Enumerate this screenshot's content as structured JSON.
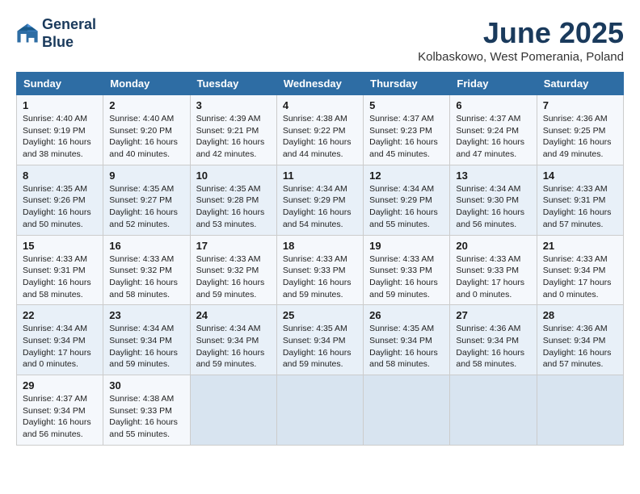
{
  "header": {
    "logo_line1": "General",
    "logo_line2": "Blue",
    "month_title": "June 2025",
    "location": "Kolbaskowo, West Pomerania, Poland"
  },
  "days_of_week": [
    "Sunday",
    "Monday",
    "Tuesday",
    "Wednesday",
    "Thursday",
    "Friday",
    "Saturday"
  ],
  "weeks": [
    [
      {
        "day": "1",
        "info": "Sunrise: 4:40 AM\nSunset: 9:19 PM\nDaylight: 16 hours\nand 38 minutes."
      },
      {
        "day": "2",
        "info": "Sunrise: 4:40 AM\nSunset: 9:20 PM\nDaylight: 16 hours\nand 40 minutes."
      },
      {
        "day": "3",
        "info": "Sunrise: 4:39 AM\nSunset: 9:21 PM\nDaylight: 16 hours\nand 42 minutes."
      },
      {
        "day": "4",
        "info": "Sunrise: 4:38 AM\nSunset: 9:22 PM\nDaylight: 16 hours\nand 44 minutes."
      },
      {
        "day": "5",
        "info": "Sunrise: 4:37 AM\nSunset: 9:23 PM\nDaylight: 16 hours\nand 45 minutes."
      },
      {
        "day": "6",
        "info": "Sunrise: 4:37 AM\nSunset: 9:24 PM\nDaylight: 16 hours\nand 47 minutes."
      },
      {
        "day": "7",
        "info": "Sunrise: 4:36 AM\nSunset: 9:25 PM\nDaylight: 16 hours\nand 49 minutes."
      }
    ],
    [
      {
        "day": "8",
        "info": "Sunrise: 4:35 AM\nSunset: 9:26 PM\nDaylight: 16 hours\nand 50 minutes."
      },
      {
        "day": "9",
        "info": "Sunrise: 4:35 AM\nSunset: 9:27 PM\nDaylight: 16 hours\nand 52 minutes."
      },
      {
        "day": "10",
        "info": "Sunrise: 4:35 AM\nSunset: 9:28 PM\nDaylight: 16 hours\nand 53 minutes."
      },
      {
        "day": "11",
        "info": "Sunrise: 4:34 AM\nSunset: 9:29 PM\nDaylight: 16 hours\nand 54 minutes."
      },
      {
        "day": "12",
        "info": "Sunrise: 4:34 AM\nSunset: 9:29 PM\nDaylight: 16 hours\nand 55 minutes."
      },
      {
        "day": "13",
        "info": "Sunrise: 4:34 AM\nSunset: 9:30 PM\nDaylight: 16 hours\nand 56 minutes."
      },
      {
        "day": "14",
        "info": "Sunrise: 4:33 AM\nSunset: 9:31 PM\nDaylight: 16 hours\nand 57 minutes."
      }
    ],
    [
      {
        "day": "15",
        "info": "Sunrise: 4:33 AM\nSunset: 9:31 PM\nDaylight: 16 hours\nand 58 minutes."
      },
      {
        "day": "16",
        "info": "Sunrise: 4:33 AM\nSunset: 9:32 PM\nDaylight: 16 hours\nand 58 minutes."
      },
      {
        "day": "17",
        "info": "Sunrise: 4:33 AM\nSunset: 9:32 PM\nDaylight: 16 hours\nand 59 minutes."
      },
      {
        "day": "18",
        "info": "Sunrise: 4:33 AM\nSunset: 9:33 PM\nDaylight: 16 hours\nand 59 minutes."
      },
      {
        "day": "19",
        "info": "Sunrise: 4:33 AM\nSunset: 9:33 PM\nDaylight: 16 hours\nand 59 minutes."
      },
      {
        "day": "20",
        "info": "Sunrise: 4:33 AM\nSunset: 9:33 PM\nDaylight: 17 hours\nand 0 minutes."
      },
      {
        "day": "21",
        "info": "Sunrise: 4:33 AM\nSunset: 9:34 PM\nDaylight: 17 hours\nand 0 minutes."
      }
    ],
    [
      {
        "day": "22",
        "info": "Sunrise: 4:34 AM\nSunset: 9:34 PM\nDaylight: 17 hours\nand 0 minutes."
      },
      {
        "day": "23",
        "info": "Sunrise: 4:34 AM\nSunset: 9:34 PM\nDaylight: 16 hours\nand 59 minutes."
      },
      {
        "day": "24",
        "info": "Sunrise: 4:34 AM\nSunset: 9:34 PM\nDaylight: 16 hours\nand 59 minutes."
      },
      {
        "day": "25",
        "info": "Sunrise: 4:35 AM\nSunset: 9:34 PM\nDaylight: 16 hours\nand 59 minutes."
      },
      {
        "day": "26",
        "info": "Sunrise: 4:35 AM\nSunset: 9:34 PM\nDaylight: 16 hours\nand 58 minutes."
      },
      {
        "day": "27",
        "info": "Sunrise: 4:36 AM\nSunset: 9:34 PM\nDaylight: 16 hours\nand 58 minutes."
      },
      {
        "day": "28",
        "info": "Sunrise: 4:36 AM\nSunset: 9:34 PM\nDaylight: 16 hours\nand 57 minutes."
      }
    ],
    [
      {
        "day": "29",
        "info": "Sunrise: 4:37 AM\nSunset: 9:34 PM\nDaylight: 16 hours\nand 56 minutes."
      },
      {
        "day": "30",
        "info": "Sunrise: 4:38 AM\nSunset: 9:33 PM\nDaylight: 16 hours\nand 55 minutes."
      },
      {
        "day": "",
        "info": ""
      },
      {
        "day": "",
        "info": ""
      },
      {
        "day": "",
        "info": ""
      },
      {
        "day": "",
        "info": ""
      },
      {
        "day": "",
        "info": ""
      }
    ]
  ]
}
